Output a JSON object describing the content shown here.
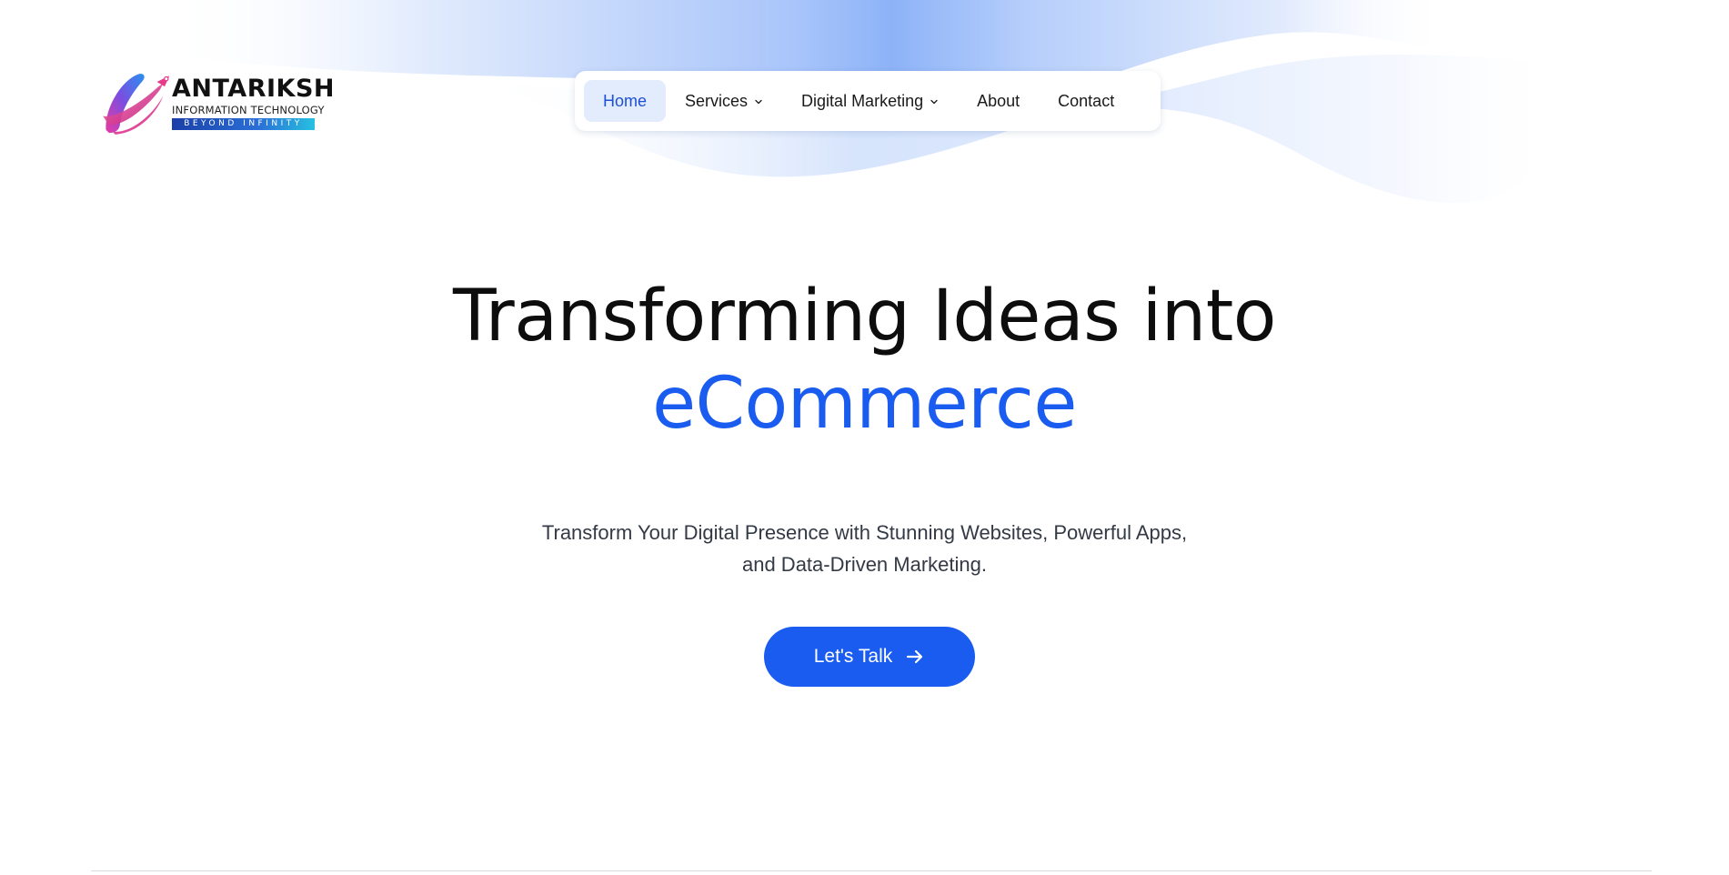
{
  "brand": {
    "name": "ANTARIKSH",
    "subtitle": "INFORMATION TECHNOLOGY",
    "tagline": "BEYOND INFINITY",
    "logo_icon": "rocket-swoosh-logo"
  },
  "nav": {
    "items": [
      {
        "label": "Home",
        "active": true
      },
      {
        "label": "Services",
        "dropdown": true,
        "icon": "chevron-down-icon"
      },
      {
        "label": "Digital Marketing",
        "dropdown": true,
        "icon": "chevron-down-icon"
      },
      {
        "label": "About"
      },
      {
        "label": "Contact"
      }
    ]
  },
  "hero": {
    "title_line1": "Transforming Ideas into",
    "title_highlight": "eCommerce",
    "subtitle_line1": "Transform Your Digital Presence with Stunning Websites, Powerful Apps,",
    "subtitle_line2": "and Data-Driven Marketing.",
    "cta_label": "Let's Talk",
    "cta_icon": "arrow-right-icon"
  },
  "colors": {
    "accent": "#1a5cf0",
    "nav_active_bg": "#e2ecfd",
    "title": "#0d0d0d",
    "wave_light": "#dbe7fd",
    "wave_mid": "#8fb4f7"
  }
}
